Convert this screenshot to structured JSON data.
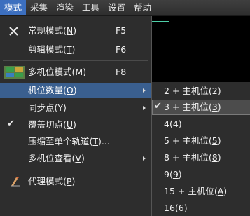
{
  "menubar": {
    "items": [
      "模式",
      "采集",
      "渲染",
      "工具",
      "设置",
      "帮助"
    ]
  },
  "menu": {
    "normal_mode": {
      "label": "常规模式(",
      "key": "N",
      "tail": ")",
      "shortcut": "F5"
    },
    "edit_mode": {
      "label": "剪辑模式(",
      "key": "T",
      "tail": ")",
      "shortcut": "F6"
    },
    "multicam_mode": {
      "label": "多机位模式(",
      "key": "M",
      "tail": ")",
      "shortcut": "F8"
    },
    "camera_count": {
      "label": "机位数量(",
      "key": "O",
      "tail": ")"
    },
    "sync_point": {
      "label": "同步点(",
      "key": "Y",
      "tail": ")"
    },
    "overwrite_cut": {
      "label": "覆盖切点(",
      "key": "U",
      "tail": ")"
    },
    "compress_track": {
      "label": "压缩至单个轨道(",
      "key": "T",
      "tail": ")..."
    },
    "multicam_view": {
      "label": "多机位查看(",
      "key": "V",
      "tail": ")"
    },
    "proxy_mode": {
      "label": "代理模式(",
      "key": "P",
      "tail": ")"
    }
  },
  "submenu": {
    "items": [
      {
        "label": "2 + 主机位(",
        "key": "2",
        "tail": ")"
      },
      {
        "label": "3 + 主机位(",
        "key": "3",
        "tail": ")"
      },
      {
        "label": "4(",
        "key": "4",
        "tail": ")"
      },
      {
        "label": "5 + 主机位(",
        "key": "5",
        "tail": ")"
      },
      {
        "label": "8 + 主机位(",
        "key": "8",
        "tail": ")"
      },
      {
        "label": "9(",
        "key": "9",
        "tail": ")"
      },
      {
        "label": "15 + 主机位(",
        "key": "A",
        "tail": ")"
      },
      {
        "label": "16(",
        "key": "6",
        "tail": ")"
      }
    ]
  },
  "colors": {
    "menubar_active": "#3c6fbf",
    "hover": "#3a5f8f",
    "canvas_border": "#4ecfa8"
  }
}
